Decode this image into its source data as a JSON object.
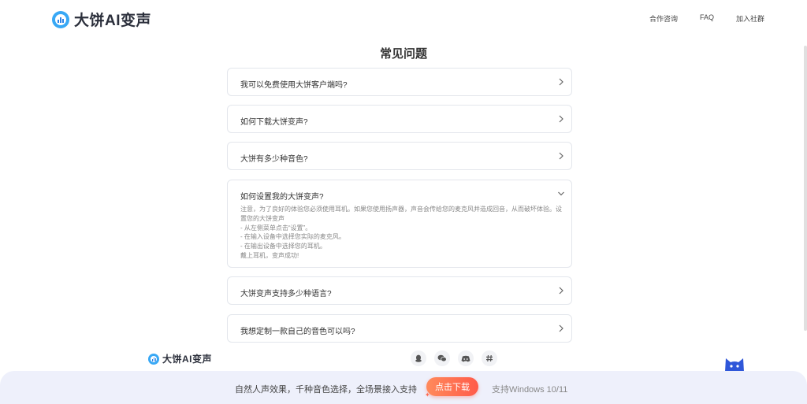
{
  "header": {
    "brand": "大饼AI变声",
    "nav": [
      "合作咨询",
      "FAQ",
      "加入社群"
    ]
  },
  "page_title": "常见问题",
  "faqs": [
    {
      "question": "我可以免费使用大饼客户端吗?",
      "expanded": false,
      "answer": []
    },
    {
      "question": "如何下载大饼变声?",
      "expanded": false,
      "answer": []
    },
    {
      "question": "大饼有多少种音色?",
      "expanded": false,
      "answer": []
    },
    {
      "question": "如何设置我的大饼变声?",
      "expanded": true,
      "answer": [
        "注意，为了良好的体验您必须使用耳机。如果您使用扬声器，声音会传给您的麦克风并造成回音，从而破坏体验。设置您的大饼变声",
        "- 从左侧菜单点击“设置”。",
        "- 在输入设备中选择您实际的麦克风。",
        "- 在输出设备中选择您的耳机。",
        "戴上耳机，变声成功!"
      ]
    },
    {
      "question": "大饼变声支持多少种语言?",
      "expanded": false,
      "answer": []
    },
    {
      "question": "我想定制一款自己的音色可以吗?",
      "expanded": false,
      "answer": []
    }
  ],
  "footer": {
    "brand": "大饼AI变声",
    "social_icons": [
      "qq-icon",
      "wechat-icon",
      "discord-icon",
      "hashtag-icon"
    ]
  },
  "bottom_bar": {
    "tagline": "自然人声效果，千种音色选择，全场景接入支持",
    "download_label": "点击下载",
    "support": "支持Windows 10/11"
  },
  "colors": {
    "brand_blue": "#38a8f5",
    "download_start": "#ff8a5c",
    "download_end": "#ff5b4a",
    "bar_bg": "#eef0fb"
  }
}
